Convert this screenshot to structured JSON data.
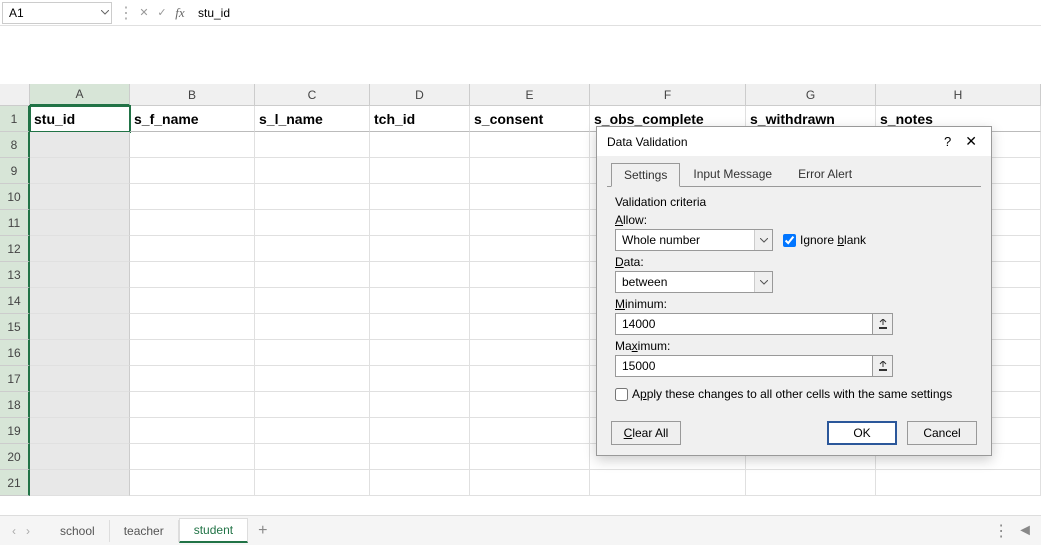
{
  "namebox": "A1",
  "formula": "stu_id",
  "columns": [
    "A",
    "B",
    "C",
    "D",
    "E",
    "F",
    "G",
    "H"
  ],
  "rows_visible": [
    1,
    8,
    9,
    10,
    11,
    12,
    13,
    14,
    15,
    16,
    17,
    18,
    19,
    20,
    21
  ],
  "headers": {
    "A": "stu_id",
    "B": "s_f_name",
    "C": "s_l_name",
    "D": "tch_id",
    "E": "s_consent",
    "F": "s_obs_complete",
    "G": "s_withdrawn",
    "H": "s_notes"
  },
  "sheet_tabs": [
    "school",
    "teacher",
    "student"
  ],
  "active_tab": "student",
  "dialog": {
    "title": "Data Validation",
    "tabs": [
      "Settings",
      "Input Message",
      "Error Alert"
    ],
    "active_tab": "Settings",
    "section": "Validation criteria",
    "allow_label": "Allow:",
    "allow_value": "Whole number",
    "ignore_blank_label": "Ignore blank",
    "ignore_blank_checked": true,
    "data_label": "Data:",
    "data_value": "between",
    "min_label": "Minimum:",
    "min_value": "14000",
    "max_label": "Maximum:",
    "max_value": "15000",
    "apply_label": "Apply these changes to all other cells with the same settings",
    "apply_checked": false,
    "clear_btn": "Clear All",
    "ok_btn": "OK",
    "cancel_btn": "Cancel"
  }
}
